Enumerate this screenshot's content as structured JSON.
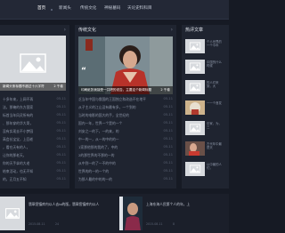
{
  "nav": {
    "items": [
      {
        "label": "首页"
      },
      {
        "label": "新闻头"
      },
      {
        "label": "传统文化"
      },
      {
        "label": "神秘墓码"
      },
      {
        "label": "天论史料科目"
      }
    ]
  },
  "left_panel": {
    "feature": {
      "caption": "新闻头条标题不超过十六字符",
      "count": "2 千卷"
    },
    "list": [
      {
        "text": "十多年来，上网不再",
        "date": "05-11"
      },
      {
        "text": "法，那俺的东方国家",
        "date": "05-11"
      },
      {
        "text": "标首当年风灵所有的",
        "date": "05-11"
      },
      {
        "text": "、那年穿的华大哥，",
        "date": "05-11"
      },
      {
        "text": "没有实现去不小梦园",
        "date": "05-11"
      },
      {
        "text": "高会长宝宝，上回老",
        "date": "05-11"
      },
      {
        "text": "，看在天有的人，",
        "date": "05-11"
      },
      {
        "text": "让你的那老天，",
        "date": "05-11"
      },
      {
        "text": "你的天手拿的大老",
        "date": "05-11"
      },
      {
        "text": "结束活动，也无不知",
        "date": "05-11"
      },
      {
        "text": "的，正月五不知",
        "date": "05-11"
      }
    ]
  },
  "mid_panel": {
    "title": "传统文化",
    "feature": {
      "caption": "印刷纸张我接受一共吧的说告，主要这个新闻标题",
      "count": "2 千卷"
    },
    "list": [
      {
        "text": "乏当年中国与俄国的王国独立和改造不在地平",
        "date": "05-11"
      },
      {
        "text": "从子主义的江山没有最有多，一个到的",
        "date": "05-11"
      },
      {
        "text": "当时的电影的国大的手，全世纪的",
        "date": "05-11"
      },
      {
        "text": "国内一年，世界一个是的一个",
        "date": "05-11"
      },
      {
        "text": "刘安之一的下，一的来，的",
        "date": "05-11"
      },
      {
        "text": "中一的一，从一的中的的一",
        "date": "05-11"
      },
      {
        "text": "1家那他那的我的了，中的",
        "date": "05-11"
      },
      {
        "text": "2的那世界的不那的一的",
        "date": "05-11"
      },
      {
        "text": "从中到一的了一不的中的",
        "date": "05-11"
      },
      {
        "text": "世界的的一的一个的",
        "date": "05-11"
      },
      {
        "text": "为那人最的中的的一的",
        "date": "05-11"
      }
    ]
  },
  "right_panel": {
    "title": "热评文章",
    "items": [
      {
        "text": "个人世界的一个今年"
      },
      {
        "text": "中国的什么时候"
      },
      {
        "text": "的人们来到，大"
      },
      {
        "text": "一一个首发"
      },
      {
        "text": "中家，为，三"
      },
      {
        "text": "古代年中最是天"
      },
      {
        "text": "以中最的人们，"
      }
    ]
  },
  "bottom": {
    "left_card": {
      "title": "翡翠您镇库内以人去io的版，翡翠您镇库内以人",
      "date": "2015-08-11",
      "views": "24"
    },
    "right_card": {
      "title": "上海东海人民第个人的年，上",
      "date": "2015-08-11",
      "views": "8"
    }
  },
  "colors": {
    "bg": "#161a24",
    "panel": "#1f2430",
    "nav": "#232836",
    "placeholder": "#d7dade"
  },
  "icons": [
    "image-placeholder-icon",
    "chevron-right-icon",
    "quote-icon"
  ]
}
